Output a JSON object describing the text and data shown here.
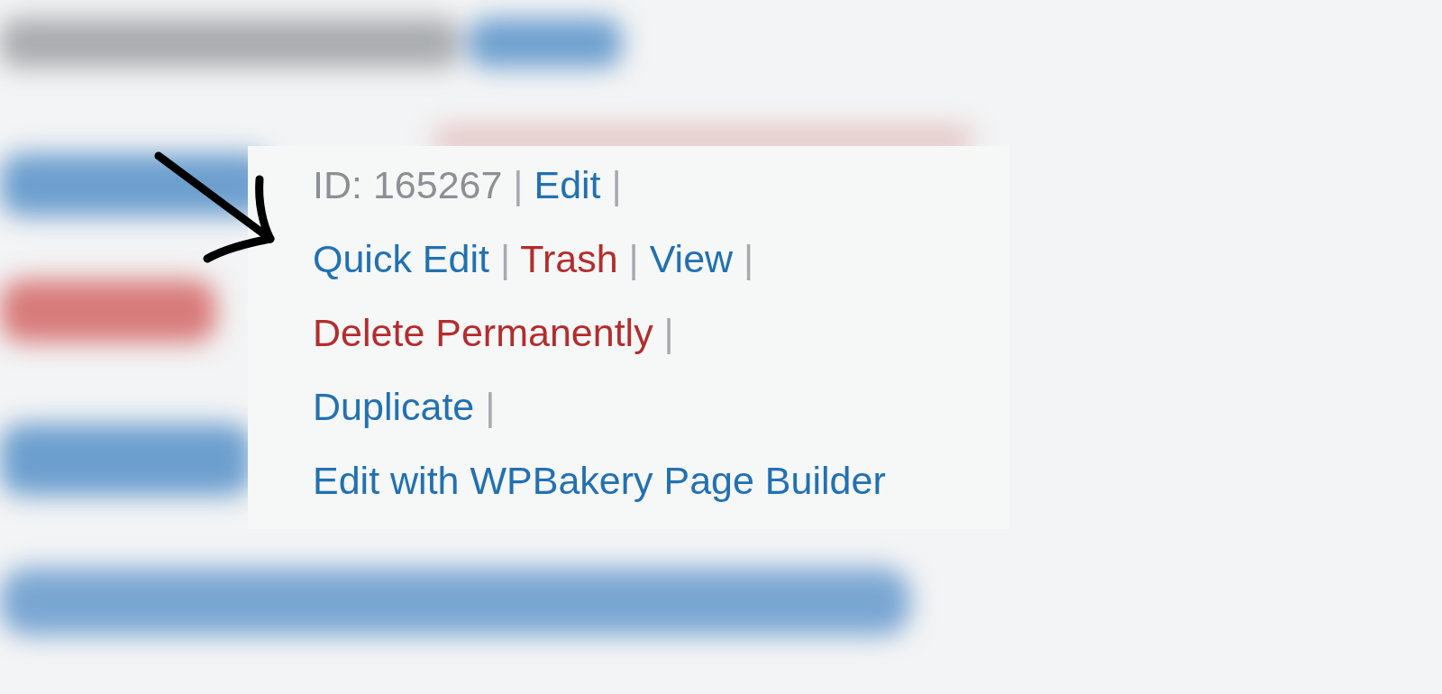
{
  "row_actions": [
    {
      "kind": "label",
      "text": "ID: 165267",
      "separator": "|"
    },
    {
      "kind": "link",
      "text": "Edit",
      "separator": "|"
    },
    {
      "kind": "link",
      "text": "Quick Edit",
      "separator": "|"
    },
    {
      "kind": "danger-link",
      "text": "Trash",
      "separator": "|"
    },
    {
      "kind": "link",
      "text": "View",
      "separator": "|"
    },
    {
      "kind": "danger-link",
      "text": "Delete Permanently",
      "separator": "|"
    },
    {
      "kind": "link",
      "text": "Duplicate",
      "separator": "|"
    },
    {
      "kind": "link",
      "text": "Edit with WPBakery Page Builder"
    }
  ]
}
